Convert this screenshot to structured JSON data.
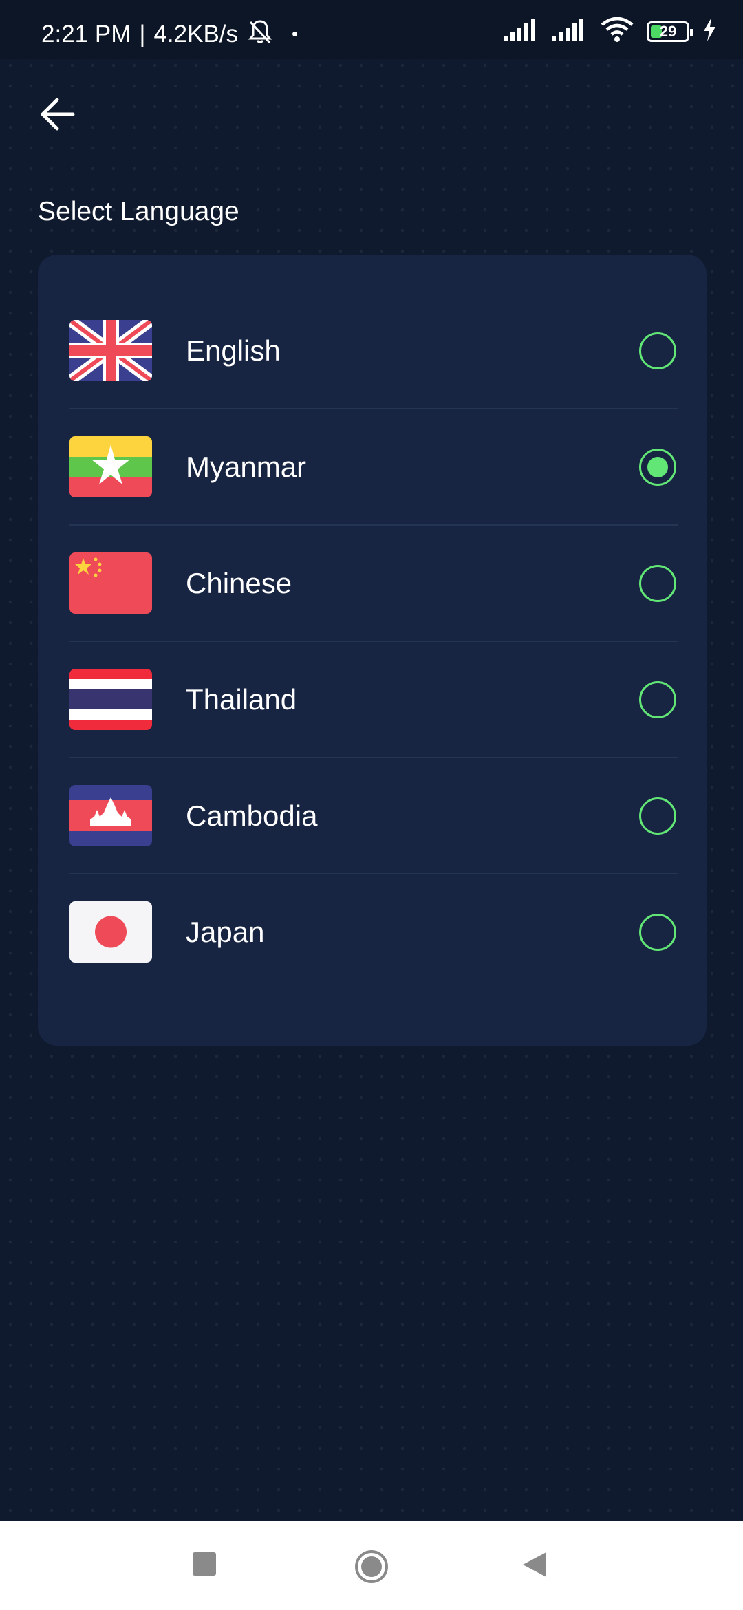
{
  "status_bar": {
    "time": "2:21 PM",
    "separator": "|",
    "net_speed": "4.2KB/s",
    "dot": "•",
    "battery_level": "29"
  },
  "header": {
    "back_icon": "arrow-left-icon"
  },
  "page": {
    "title": "Select Language"
  },
  "languages": [
    {
      "label": "English",
      "flag": "uk-flag-icon",
      "selected": false
    },
    {
      "label": "Myanmar",
      "flag": "myanmar-flag-icon",
      "selected": true
    },
    {
      "label": "Chinese",
      "flag": "china-flag-icon",
      "selected": false
    },
    {
      "label": "Thailand",
      "flag": "thailand-flag-icon",
      "selected": false
    },
    {
      "label": "Cambodia",
      "flag": "cambodia-flag-icon",
      "selected": false
    },
    {
      "label": "Japan",
      "flag": "japan-flag-icon",
      "selected": false
    }
  ],
  "nav_bar": {
    "recents_icon": "square-icon",
    "home_icon": "circle-icon",
    "back_icon": "triangle-back-icon"
  },
  "colors": {
    "background": "#0f1a2e",
    "card": "#172442",
    "accent": "#62e676"
  }
}
